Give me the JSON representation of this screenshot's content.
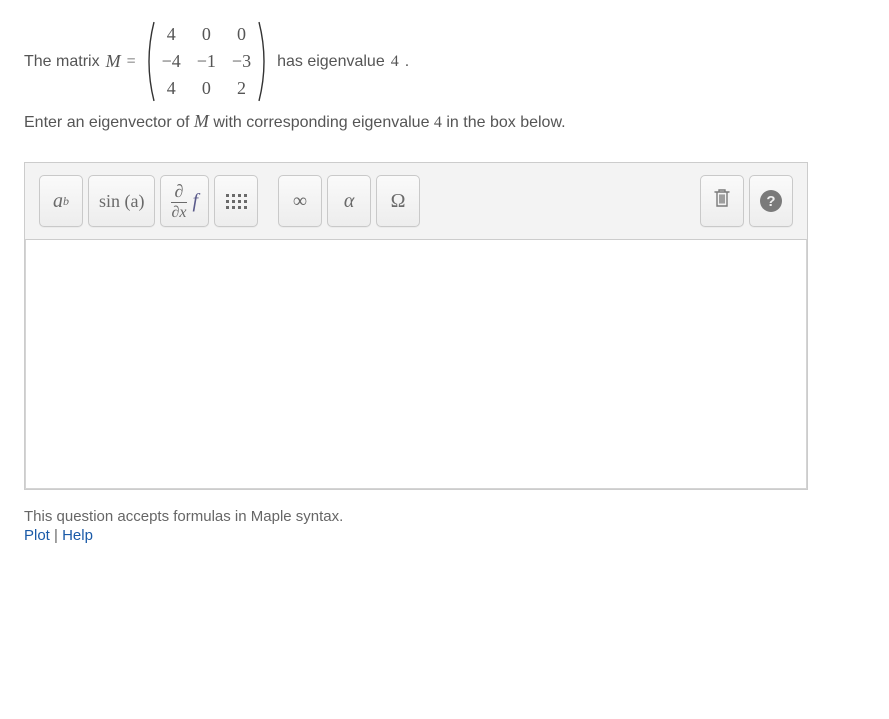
{
  "prompt": {
    "prefix": "The matrix ",
    "matrix_symbol": "M",
    "equals": " = ",
    "matrix": {
      "rows": [
        [
          "4",
          "0",
          "0"
        ],
        [
          "−4",
          "−1",
          "−3"
        ],
        [
          "4",
          "0",
          "2"
        ]
      ]
    },
    "suffix_after_matrix_a": " has eigenvalue ",
    "eigenvalue": "4",
    "suffix_after_matrix_b": ".",
    "line2_a": "Enter an eigenvector of ",
    "line2_symbol": "M",
    "line2_b": " with corresponding eigenvalue ",
    "line2_eigenvalue": "4",
    "line2_c": " in the box below."
  },
  "toolbar": {
    "power_base": "a",
    "power_exp": "b",
    "trig_label": "sin (a)",
    "deriv_top": "∂",
    "deriv_bot": "∂x",
    "deriv_f": "f",
    "infinity": "∞",
    "alpha": "α",
    "omega": "Ω"
  },
  "input": {
    "value": "",
    "placeholder": ""
  },
  "footer": {
    "note": "This question accepts formulas in Maple syntax.",
    "plot_label": "Plot",
    "separator": " | ",
    "help_label": "Help"
  }
}
